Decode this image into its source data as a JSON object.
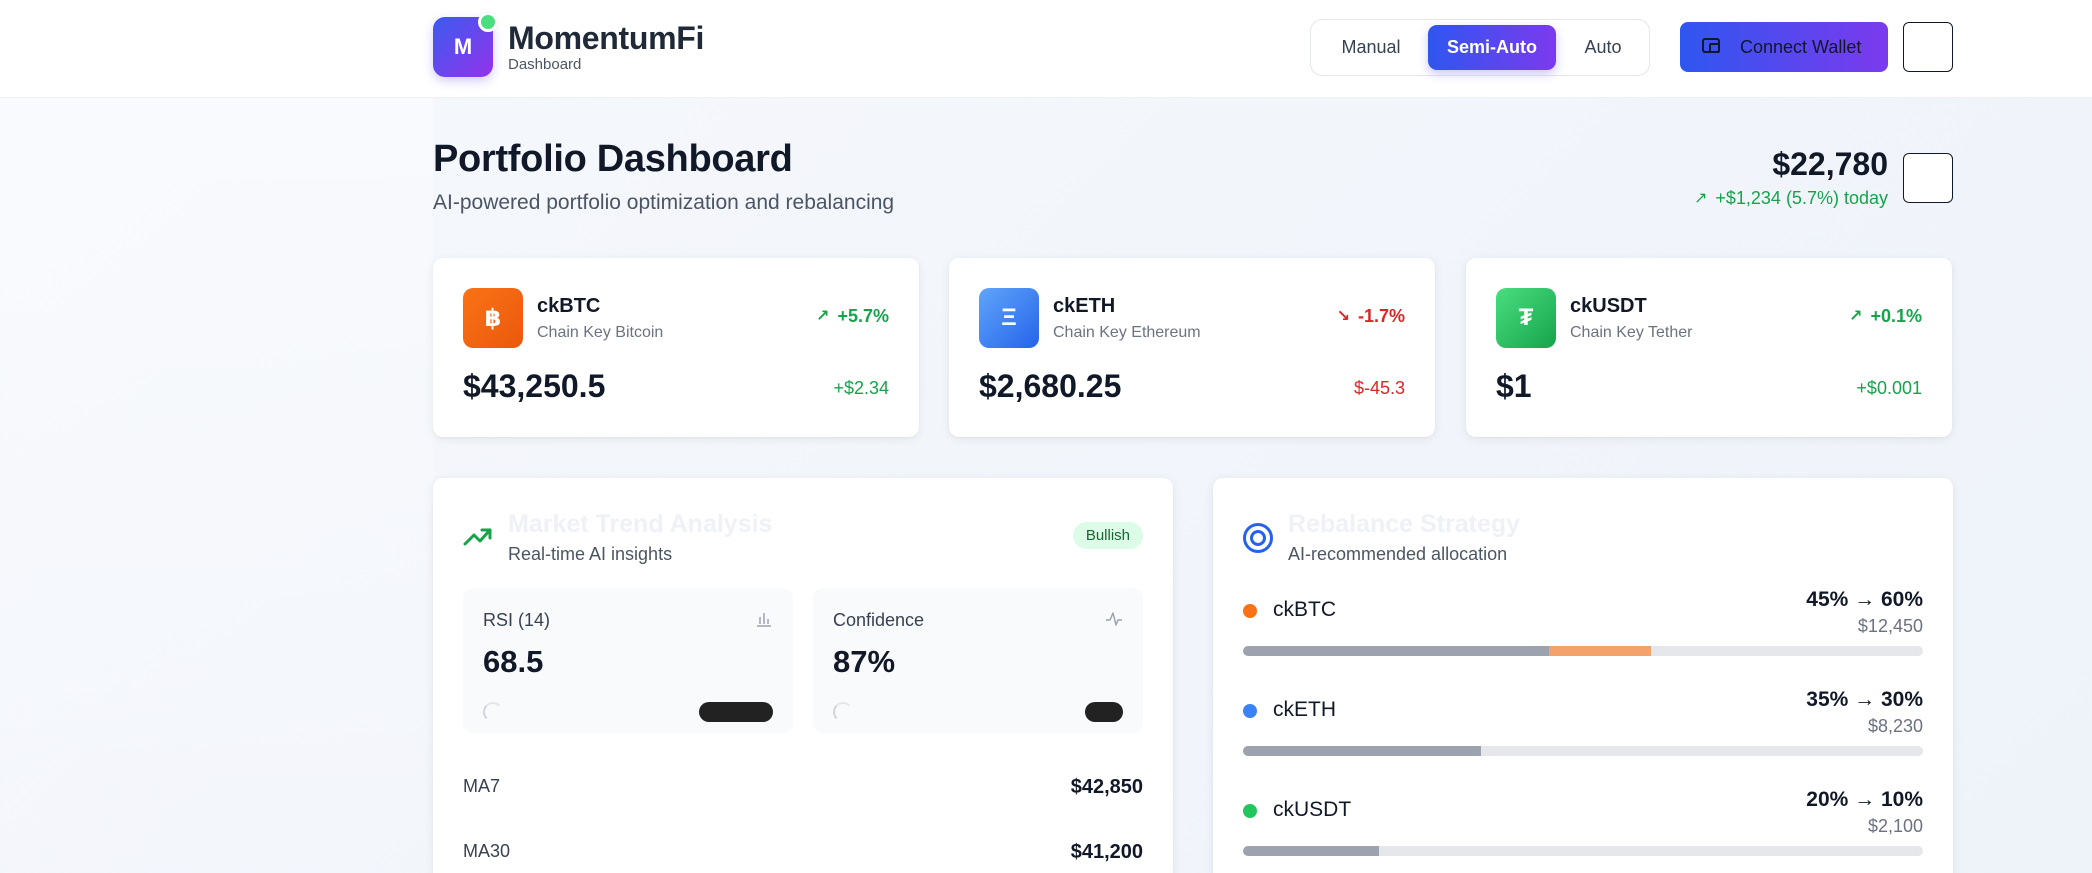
{
  "header": {
    "logo_letter": "M",
    "brand": "MomentumFi",
    "subtitle": "Dashboard",
    "modes": [
      "Manual",
      "Semi-Auto",
      "Auto"
    ],
    "active_mode": "Semi-Auto",
    "connect_label": "Connect Wallet"
  },
  "page": {
    "title": "Portfolio Dashboard",
    "subtitle": "AI-powered portfolio optimization and rebalancing",
    "total_value": "$22,780",
    "total_change": "+$1,234 (5.7%) today"
  },
  "assets": [
    {
      "symbol": "ckBTC",
      "name": "Chain Key Bitcoin",
      "icon": "฿",
      "icon_name": "bitcoin-icon",
      "change_pct": "+5.7%",
      "direction": "up",
      "price": "$43,250.5",
      "delta": "+$2.34",
      "colors": [
        "#f97316",
        "#ea580c"
      ]
    },
    {
      "symbol": "ckETH",
      "name": "Chain Key Ethereum",
      "icon": "Ξ",
      "icon_name": "ethereum-icon",
      "change_pct": "-1.7%",
      "direction": "down",
      "price": "$2,680.25",
      "delta": "$-45.3",
      "colors": [
        "#60a5fa",
        "#2563eb"
      ]
    },
    {
      "symbol": "ckUSDT",
      "name": "Chain Key Tether",
      "icon": "₮",
      "icon_name": "tether-icon",
      "change_pct": "+0.1%",
      "direction": "up",
      "price": "$1",
      "delta": "+$0.001",
      "colors": [
        "#4ade80",
        "#16a34a"
      ]
    }
  ],
  "market": {
    "title": "Market Trend Analysis",
    "subtitle": "Real-time AI insights",
    "badge": "Bullish",
    "rsi": {
      "label": "RSI (14)",
      "value": "68.5",
      "fill": 0.685
    },
    "confidence": {
      "label": "Confidence",
      "value": "87%",
      "fill": 0.87
    },
    "ma": [
      {
        "label": "MA7",
        "value": "$42,850"
      },
      {
        "label": "MA30",
        "value": "$41,200"
      }
    ]
  },
  "rebalance": {
    "title": "Rebalance Strategy",
    "subtitle": "AI-recommended allocation",
    "items": [
      {
        "symbol": "ckBTC",
        "change": "45% → 60%",
        "amount": "$12,450",
        "current": 45,
        "target": 60,
        "color": "#f97316",
        "target_color": "#f4a26b"
      },
      {
        "symbol": "ckETH",
        "change": "35% → 30%",
        "amount": "$8,230",
        "current": 35,
        "target": 30,
        "color": "#3b82f6",
        "target_color": "#9ca3af"
      },
      {
        "symbol": "ckUSDT",
        "change": "20% → 10%",
        "amount": "$2,100",
        "current": 20,
        "target": 10,
        "color": "#22c55e",
        "target_color": "#9ca3af"
      }
    ]
  }
}
